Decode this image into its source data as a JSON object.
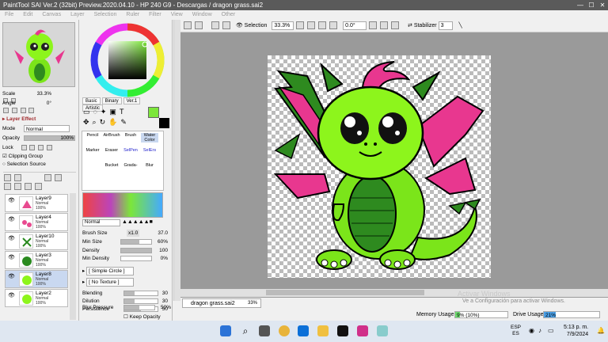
{
  "window": {
    "title": "PaintTool SAI Ver.2 (32bit) Preview.2020.04.10 - HP 240 G9 - Descargas / dragon grass.sai2"
  },
  "menu": [
    "File",
    "Edit",
    "Canvas",
    "Layer",
    "Selection",
    "Ruler",
    "Filter",
    "View",
    "Window",
    "Other"
  ],
  "nav": {
    "scale_label": "Scale",
    "scale_value": "33.3%",
    "angle_label": "Angle",
    "angle_value": "0°"
  },
  "layer_effect": {
    "title": "Layer Effect",
    "mode_label": "Mode",
    "mode_value": "Normal",
    "opacity_label": "Opacity",
    "opacity_value": "100%",
    "lock_label": "Lock",
    "clipping_label": "Clipping Group",
    "selection_label": "Selection Source"
  },
  "layers": [
    {
      "name": "Layer9",
      "mode": "Normal",
      "opacity": "100%"
    },
    {
      "name": "Layer4",
      "mode": "Normal",
      "opacity": "100%"
    },
    {
      "name": "Layer10",
      "mode": "Normal",
      "opacity": "100%"
    },
    {
      "name": "Layer3",
      "mode": "Normal",
      "opacity": "100%"
    },
    {
      "name": "Layer8",
      "mode": "Normal",
      "opacity": "100%"
    },
    {
      "name": "Layer2",
      "mode": "Normal",
      "opacity": "100%"
    }
  ],
  "color_tabs": [
    "Basic",
    "Binary",
    "Ver.1",
    "Artistic"
  ],
  "tools": [
    {
      "name": "Pencil"
    },
    {
      "name": "AirBrush"
    },
    {
      "name": "Brush"
    },
    {
      "name": "Water Color"
    },
    {
      "name": "Marker"
    },
    {
      "name": "Eraser"
    },
    {
      "name": "SelPen"
    },
    {
      "name": "SelErs"
    },
    {
      "name": "Bucket"
    },
    {
      "name": "Grada-"
    },
    {
      "name": "Blur"
    }
  ],
  "brush": {
    "mode": "Normal",
    "size_label": "Brush Size",
    "size_mult": "x1.0",
    "size_value": "37.0",
    "min_size_label": "Min Size",
    "min_size_value": "60%",
    "density_label": "Density",
    "density_value": "100",
    "min_density_label": "Min Density",
    "min_density_value": "0%",
    "shape": "[ Simple Circle ]",
    "texture": "[ No Texture ]",
    "blending_label": "Blending",
    "blending_value": "30",
    "dilution_label": "Dilution",
    "dilution_value": "30",
    "persistence_label": "Persistence",
    "persistence_value": "50",
    "keep_opacity_label": "Keep Opacity",
    "blur_pressure_label": "Blur Pressure",
    "blur_pressure_value": "50%"
  },
  "toolbar": {
    "selection_label": "Selection",
    "zoom": "33.3%",
    "angle": "0.0°",
    "stabilizer_label": "Stabilizer",
    "stabilizer_value": "3"
  },
  "document": {
    "tab_name": "dragon grass.sai2",
    "tab_zoom": "33%"
  },
  "status": {
    "memory_label": "Memory Usage",
    "memory_value": "9% (10%)",
    "drive_label": "Drive Usage",
    "drive_value": "21%",
    "watermark_title": "Activar Windows",
    "watermark_sub": "Ve a Configuración para activar Windows."
  },
  "taskbar": {
    "lang": "ESP",
    "lang2": "ES",
    "time": "5:13 p. m.",
    "date": "7/9/2024"
  }
}
